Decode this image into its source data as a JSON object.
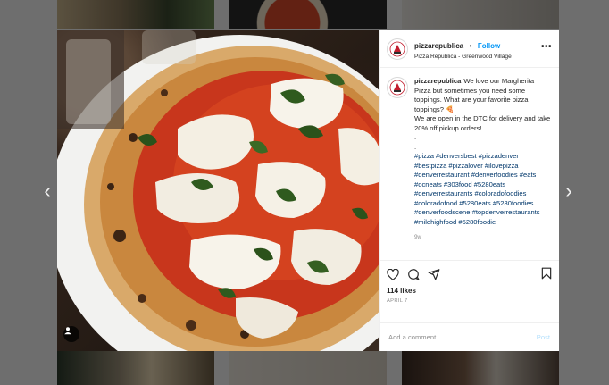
{
  "post": {
    "username": "pizzarepublica",
    "separator": "•",
    "follow_label": "Follow",
    "location": "Pizza Republica - Greenwood Village",
    "more_icon": "more-options-icon",
    "caption_text": "We love our Margherita Pizza but sometimes you need some toppings. What are your favorite pizza toppings? 🍕\nWe are open in the DTC for delivery and take 20% off pickup orders!\n.\n.",
    "hashtags": "#pizza #denversbest #pizzadenver #bestpizza #pizzalover #ilovepizza #denverrestaurant #denverfoodies #eats #ocneats #303food #5280eats #denverrestaurants #coloradofoodies #coloradofood #5280eats #5280foodies #denverfoodscene #topdenverrestaurants #milehighfood #5280foodie",
    "time_ago": "9w",
    "likes": "114 likes",
    "date": "APRIL 7",
    "comment_placeholder": "Add a comment...",
    "post_label": "Post"
  },
  "nav": {
    "prev_arrow": "‹",
    "next_arrow": "›"
  },
  "colors": {
    "follow": "#0095f6",
    "hashtag": "#00376b",
    "post_disabled": "#b2dffc",
    "overlay": "#6e6e6e"
  },
  "icons": [
    "heart-icon",
    "comment-icon",
    "share-icon",
    "bookmark-icon",
    "user-tag-icon",
    "chevron-left-icon",
    "chevron-right-icon"
  ]
}
